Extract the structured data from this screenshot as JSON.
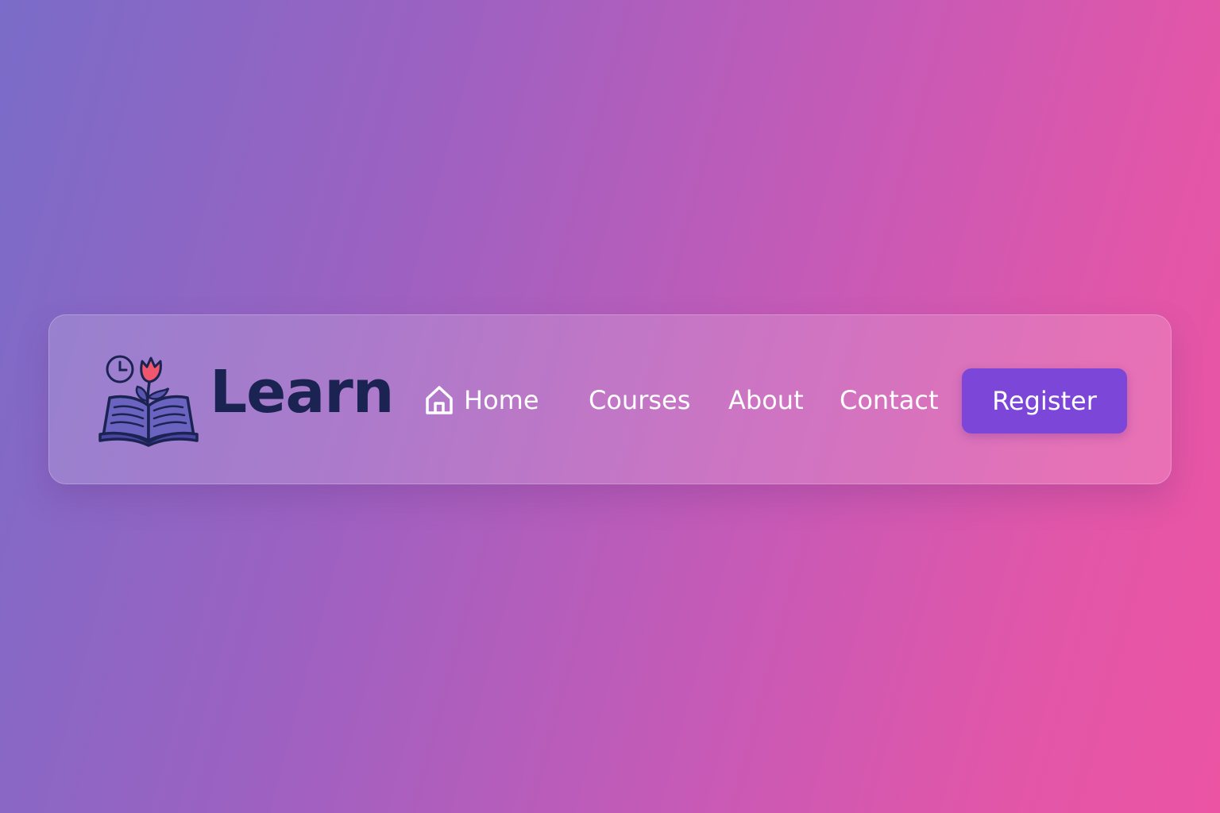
{
  "brand": {
    "name": "Learn",
    "logo_icon": "open-book-sprout-clock-icon"
  },
  "nav": {
    "items": [
      {
        "label": "Home",
        "icon": "home-icon"
      },
      {
        "label": "Courses"
      },
      {
        "label": "About"
      },
      {
        "label": "Contact"
      }
    ],
    "register_label": "Register"
  },
  "colors": {
    "background_start": "#7a6cc8",
    "background_end": "#ec54a3",
    "brand_text": "#1a2352",
    "register_button": "#7c46d8",
    "nav_text": "#ffffff"
  }
}
